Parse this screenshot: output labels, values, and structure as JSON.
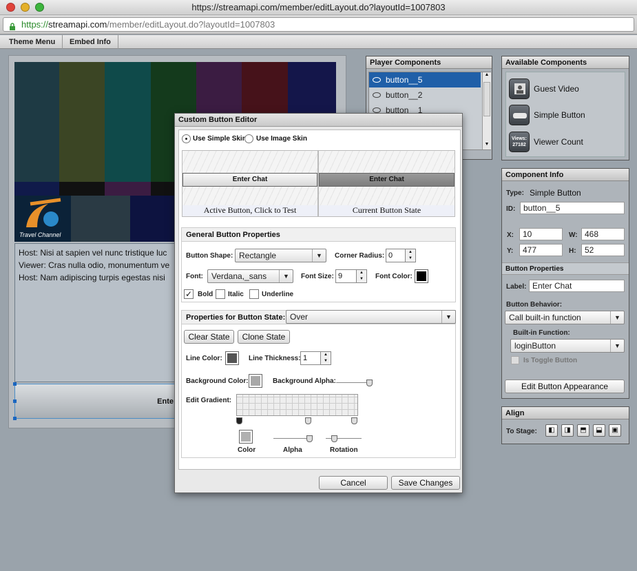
{
  "window": {
    "title": "https://streamapi.com/member/editLayout.do?layoutId=1007803",
    "url_scheme": "https://",
    "url_domain": "streamapi.com",
    "url_path": "/member/editLayout.do?layoutId=1007803"
  },
  "menu": {
    "items": [
      "Theme Menu",
      "Embed Info"
    ]
  },
  "player": {
    "logo_text": "Travel Channel",
    "chat_lines": [
      "Host: Nisi at sapien vel nunc tristique luc",
      "Viewer: Cras nulla odio, monumentum ve",
      "Host: Nam adipiscing turpis egestas nisi"
    ],
    "button_preview_label": "Ente"
  },
  "player_components": {
    "title": "Player Components",
    "items": [
      "button__5",
      "button__2",
      "button__1"
    ],
    "selected_index": 0
  },
  "available_components": {
    "title": "Available Components",
    "items": [
      {
        "label": "Guest Video",
        "icon": "person-icon"
      },
      {
        "label": "Simple Button",
        "icon": "button-icon"
      },
      {
        "label": "Viewer Count",
        "icon": "viewer-count-icon",
        "icon_text": "Views:",
        "icon_value": "27182"
      }
    ]
  },
  "component_info": {
    "title": "Component Info",
    "type_label": "Type:",
    "type_value": "Simple Button",
    "id_label": "ID:",
    "id_value": "button__5",
    "x_label": "X:",
    "x_value": "10",
    "w_label": "W:",
    "w_value": "468",
    "y_label": "Y:",
    "y_value": "477",
    "h_label": "H:",
    "h_value": "52",
    "button_props_title": "Button Properties",
    "label_label": "Label:",
    "label_value": "Enter Chat",
    "behavior_label": "Button Behavior:",
    "behavior_value": "Call built-in function",
    "builtin_label": "Built-in Function:",
    "builtin_value": "loginButton",
    "toggle_label": "Is Toggle Button",
    "edit_appearance": "Edit Button Appearance"
  },
  "align": {
    "title": "Align",
    "to_stage_label": "To Stage:"
  },
  "dialog": {
    "title": "Custom Button Editor",
    "skin_simple": "Use Simple Skin",
    "skin_image": "Use Image Skin",
    "preview_active_label": "Enter Chat",
    "preview_current_label": "Enter Chat",
    "preview_active_caption": "Active Button, Click to Test",
    "preview_current_caption": "Current Button State",
    "general_title": "General Button Properties",
    "shape_label": "Button Shape:",
    "shape_value": "Rectangle",
    "corner_label": "Corner Radius:",
    "corner_value": "0",
    "font_label": "Font:",
    "font_value": "Verdana,_sans",
    "font_size_label": "Font Size:",
    "font_size_value": "9",
    "font_color_label": "Font Color:",
    "bold_label": "Bold",
    "italic_label": "Italic",
    "underline_label": "Underline",
    "state_title": "Properties for Button State:",
    "state_value": "Over",
    "clear_state": "Clear State",
    "clone_state": "Clone State",
    "line_color_label": "Line Color:",
    "line_thickness_label": "Line Thickness:",
    "line_thickness_value": "1",
    "bg_color_label": "Background Color:",
    "bg_alpha_label": "Background Alpha:",
    "gradient_label": "Edit Gradient:",
    "color_label": "Color",
    "alpha_label": "Alpha",
    "rotation_label": "Rotation",
    "cancel": "Cancel",
    "save": "Save Changes"
  },
  "colors": {
    "selection": "#1f5fa8",
    "font_color": "#000000",
    "line_color": "#555555",
    "bg_color": "#a8a8a8"
  }
}
